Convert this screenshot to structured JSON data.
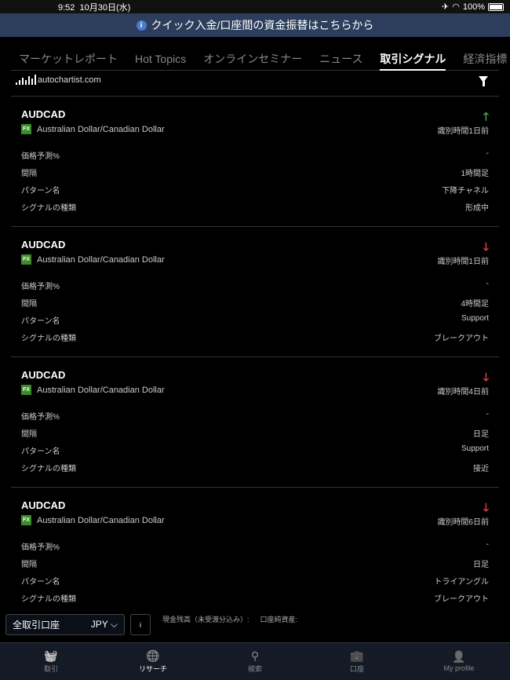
{
  "status": {
    "time": "9:52",
    "date": "10月30日(水)",
    "battery": "100%",
    "battery_level": 1.0
  },
  "banner": {
    "text": "クイック入金/口座間の資金振替はこちらから",
    "icon": "info-icon"
  },
  "tabs": [
    {
      "label": "マーケットレポート"
    },
    {
      "label": "Hot Topics"
    },
    {
      "label": "オンラインセミナー"
    },
    {
      "label": "ニュース"
    },
    {
      "label": "取引シグナル",
      "active": true
    },
    {
      "label": "経済指標"
    }
  ],
  "logo": "autochartist.com",
  "signals": [
    {
      "symbol": "AUDCAD",
      "name": "Australian Dollar/Canadian Dollar",
      "badge": "FX",
      "direction": "up",
      "time": "識別時間1日前",
      "rows": [
        {
          "label": "価格予測%",
          "value": "-"
        },
        {
          "label": "間隔",
          "value": "1時間足"
        },
        {
          "label": "パターン名",
          "value": "下降チャネル"
        },
        {
          "label": "シグナルの種類",
          "value": "形成中"
        }
      ]
    },
    {
      "symbol": "AUDCAD",
      "name": "Australian Dollar/Canadian Dollar",
      "badge": "FX",
      "direction": "down",
      "time": "識別時間1日前",
      "rows": [
        {
          "label": "価格予測%",
          "value": "-"
        },
        {
          "label": "間隔",
          "value": "4時間足"
        },
        {
          "label": "パターン名",
          "value": "Support"
        },
        {
          "label": "シグナルの種類",
          "value": "ブレークアウト"
        }
      ]
    },
    {
      "symbol": "AUDCAD",
      "name": "Australian Dollar/Canadian Dollar",
      "badge": "FX",
      "direction": "down",
      "time": "識別時間4日前",
      "rows": [
        {
          "label": "価格予測%",
          "value": "-"
        },
        {
          "label": "間隔",
          "value": "日足"
        },
        {
          "label": "パターン名",
          "value": "Support"
        },
        {
          "label": "シグナルの種類",
          "value": "接近"
        }
      ]
    },
    {
      "symbol": "AUDCAD",
      "name": "Australian Dollar/Canadian Dollar",
      "badge": "FX",
      "direction": "down",
      "time": "識別時間6日前",
      "rows": [
        {
          "label": "価格予測%",
          "value": "-"
        },
        {
          "label": "間隔",
          "value": "日足"
        },
        {
          "label": "パターン名",
          "value": "トライアングル"
        },
        {
          "label": "シグナルの種類",
          "value": "ブレークアウト"
        }
      ]
    }
  ],
  "account": {
    "name": "全取引口座",
    "currency": "JPY",
    "info": "i",
    "cash_label": "現金残高（未受渡分込み）:",
    "equity_label": "口座純資産:"
  },
  "nav": [
    {
      "label": "取引",
      "icon": "basket-icon"
    },
    {
      "label": "リサーチ",
      "icon": "globe-star-icon",
      "active": true
    },
    {
      "label": "検索",
      "icon": "search-icon"
    },
    {
      "label": "口座",
      "icon": "briefcase-icon"
    },
    {
      "label": "My profile",
      "icon": "person-icon"
    }
  ],
  "colors": {
    "up": "#4caf50",
    "down": "#e0453a",
    "banner": "#2c3e5c"
  }
}
